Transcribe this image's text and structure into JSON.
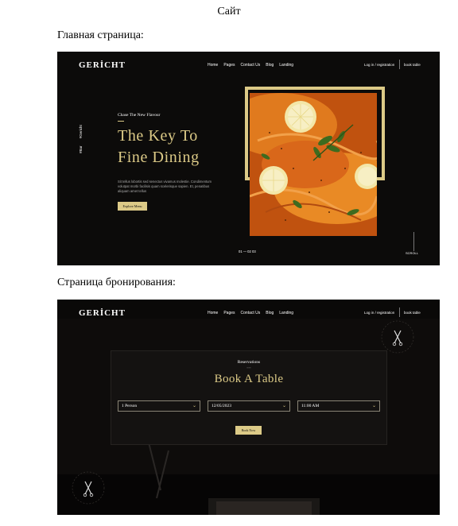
{
  "document": {
    "title": "Сайт",
    "caption_home": "Главная страница:",
    "caption_booking": "Страница бронирования:"
  },
  "nav": {
    "logo": "GERİCHT",
    "menu": [
      "Home",
      "Pages",
      "Contact Us",
      "Blog",
      "Landing"
    ],
    "login": "Log in / registration",
    "book": "book table"
  },
  "hero": {
    "social": [
      "#Bar",
      "#Gericht"
    ],
    "subtitle": "Chase The New Flavour",
    "title_line1": "The Key To",
    "title_line2": "Fine Dining",
    "description": "Sit tellus lobortis sed senectus vivamus molestie. Condimentum volutpat morbi facilisis quam scelerisque sapien. Et, penatibus aliquam amet tellus",
    "button": "Explore Menu",
    "pager": "01 — 02 03",
    "scroll": "SCROLL"
  },
  "reservation": {
    "subtitle": "Reservations",
    "title": "Book A Table",
    "fields": [
      "1 Person",
      "12/05/2023",
      "11:00 AM"
    ],
    "button": "Book Now"
  },
  "colors": {
    "gold": "#dcca87",
    "dark": "#0c0b0a"
  }
}
